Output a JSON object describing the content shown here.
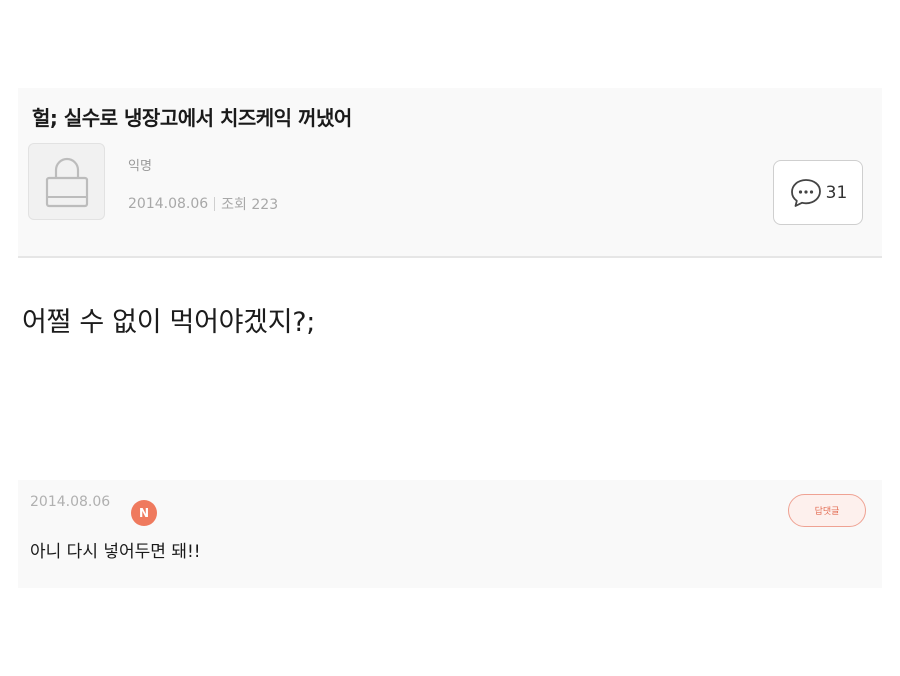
{
  "post": {
    "title": "헐; 실수로 냉장고에서 치즈케익 꺼냈어",
    "author": "익명",
    "date": "2014.08.06",
    "views": "조회 223",
    "comment_count": "31",
    "body": "어쩔 수 없이 먹어야겠지?;"
  },
  "comment": {
    "date": "2014.08.06",
    "badge": "N",
    "reply_label": "답댓글",
    "text": "아니 다시 넣어두면 돼!!"
  },
  "colors": {
    "badge": "#ef7a5e",
    "reply_border": "#efa293",
    "header_bg": "#f9f9f9"
  },
  "icons": [
    "lock-icon",
    "speech-bubble-icon"
  ]
}
